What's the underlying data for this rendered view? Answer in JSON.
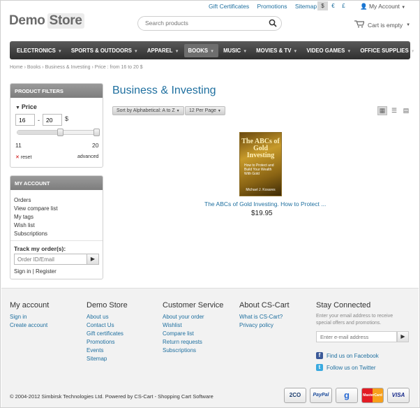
{
  "topbar": {
    "links": [
      "Gift Certificates",
      "Promotions",
      "Sitemap"
    ],
    "currencies": [
      "$",
      "€",
      "£"
    ],
    "my_account": "My Account"
  },
  "logo": {
    "part1": "Demo",
    "part2": "Store"
  },
  "search": {
    "placeholder": "Search products"
  },
  "cart": {
    "label": "Cart is empty"
  },
  "nav": {
    "items": [
      "ELECTRONICS",
      "SPORTS & OUTDOORS",
      "APPAREL",
      "BOOKS",
      "MUSIC",
      "MOVIES & TV",
      "VIDEO GAMES",
      "OFFICE SUPPLIES"
    ],
    "active": "BOOKS"
  },
  "breadcrumb": "Home › Books › Business & Investing › Price : from 16 to 20 $",
  "filters": {
    "title": "PRODUCT FILTERS",
    "price_title": "Price",
    "min": "16",
    "max": "20",
    "currency": "$",
    "range_min": "11",
    "range_max": "20",
    "reset": "reset",
    "advanced": "advanced"
  },
  "account": {
    "title": "MY ACCOUNT",
    "links": [
      "Orders",
      "View compare list",
      "My tags",
      "Wish list",
      "Subscriptions"
    ],
    "track_title": "Track my order(s):",
    "order_placeholder": "Order ID/Email",
    "signin": "Sign in",
    "register": "Register"
  },
  "main": {
    "heading": "Business & Investing",
    "sort": "Sort by Alphabetical: A to Z",
    "per_page": "12 Per Page"
  },
  "product": {
    "cover_title": "The ABCs of Gold Investing",
    "cover_subtitle": "How to Protect and Build Your Wealth With Gold",
    "cover_author": "Michael J. Kosares",
    "title": "The ABCs of Gold Investing. How to Protect ...",
    "price": "$19.95"
  },
  "footer": {
    "col1": {
      "title": "My account",
      "links": [
        "Sign in",
        "Create account"
      ]
    },
    "col2": {
      "title": "Demo Store",
      "links": [
        "About us",
        "Contact Us",
        "Gift certificates",
        "Promotions",
        "Events",
        "Sitemap"
      ]
    },
    "col3": {
      "title": "Customer Service",
      "links": [
        "About your order",
        "Wishlist",
        "Compare list",
        "Return requests",
        "Subscriptions"
      ]
    },
    "col4": {
      "title": "About CS-Cart",
      "links": [
        "What is CS-Cart?",
        "Privacy policy"
      ]
    },
    "col5": {
      "title": "Stay Connected",
      "text": "Enter your email address to receive special offers and promotions.",
      "email_placeholder": "Enter e-mail address",
      "facebook": "Find us on Facebook",
      "twitter": "Follow us on Twitter"
    },
    "copyright": "© 2004-2012 Simbirsk Technologies Ltd.  Powered by CS-Cart - Shopping Cart Software",
    "cards": [
      "2CO",
      "PayPal",
      "g",
      "MasterCard",
      "VISA"
    ]
  },
  "colors": {
    "link": "#1e6f9f",
    "nav_bg": "#3a3a3a"
  }
}
